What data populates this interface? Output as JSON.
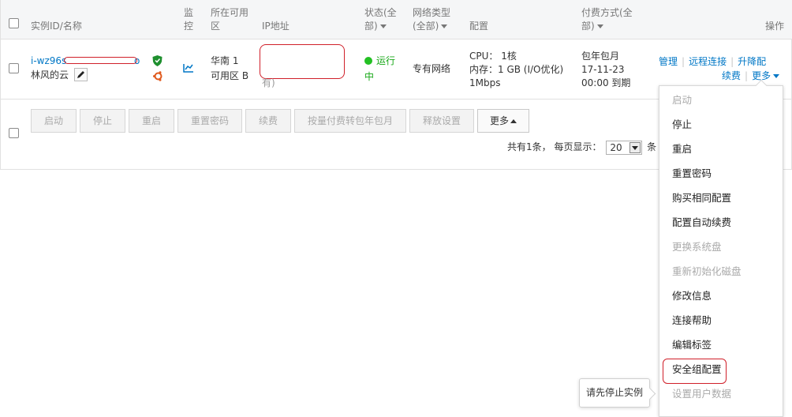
{
  "header": {
    "instance_id_name": "实例ID/名称",
    "monitor_1": "监",
    "monitor_2": "控",
    "zone_1": "所在可用",
    "zone_2": "区",
    "ip": "IP地址",
    "status_1": "状态(全",
    "status_2": "部)",
    "network_1": "网络类型",
    "network_2": "(全部)",
    "config": "配置",
    "billing_1": "付费方式(全",
    "billing_2": "部)",
    "actions": "操作"
  },
  "row": {
    "instance_id": "i-wz96s",
    "instance_id_tail": "o",
    "instance_name": "林风的云",
    "zone_line1": "华南 1",
    "zone_line2": "可用区 B",
    "ip_tail": "有)",
    "status": "运行",
    "status_2": "中",
    "network": "专有网络",
    "cpu": "CPU： 1核",
    "memory": "内存：1 GB (I/O优化)",
    "bandwidth": "1Mbps",
    "billing_type": "包年包月",
    "billing_date": "17-11-23",
    "billing_expire": "00:00 到期",
    "action_manage": "管理",
    "action_remote": "远程连接",
    "action_upgrade": "升降配",
    "action_renew": "续费",
    "action_more": "更多"
  },
  "buttons": {
    "start": "启动",
    "stop": "停止",
    "restart": "重启",
    "reset_password": "重置密码",
    "renew": "续费",
    "convert": "按量付费转包年包月",
    "release": "释放设置",
    "more": "更多"
  },
  "pager": {
    "total": "共有1条，",
    "per_page": "每页显示：",
    "page_size": "20",
    "unit": "条"
  },
  "menu": {
    "items": [
      {
        "label": "启动",
        "disabled": true
      },
      {
        "label": "停止",
        "disabled": false
      },
      {
        "label": "重启",
        "disabled": false
      },
      {
        "label": "重置密码",
        "disabled": false
      },
      {
        "label": "购买相同配置",
        "disabled": false
      },
      {
        "label": "配置自动续费",
        "disabled": false
      },
      {
        "label": "更换系统盘",
        "disabled": true
      },
      {
        "label": "重新初始化磁盘",
        "disabled": true
      },
      {
        "label": "修改信息",
        "disabled": false
      },
      {
        "label": "连接帮助",
        "disabled": false
      },
      {
        "label": "编辑标签",
        "disabled": false
      },
      {
        "label": "安全组配置",
        "disabled": false
      },
      {
        "label": "设置用户数据",
        "disabled": true
      }
    ]
  },
  "tooltip": {
    "text": "请先停止实例"
  },
  "colors": {
    "link": "#0077c6",
    "running": "#18a818",
    "highlight": "#d0202a"
  }
}
